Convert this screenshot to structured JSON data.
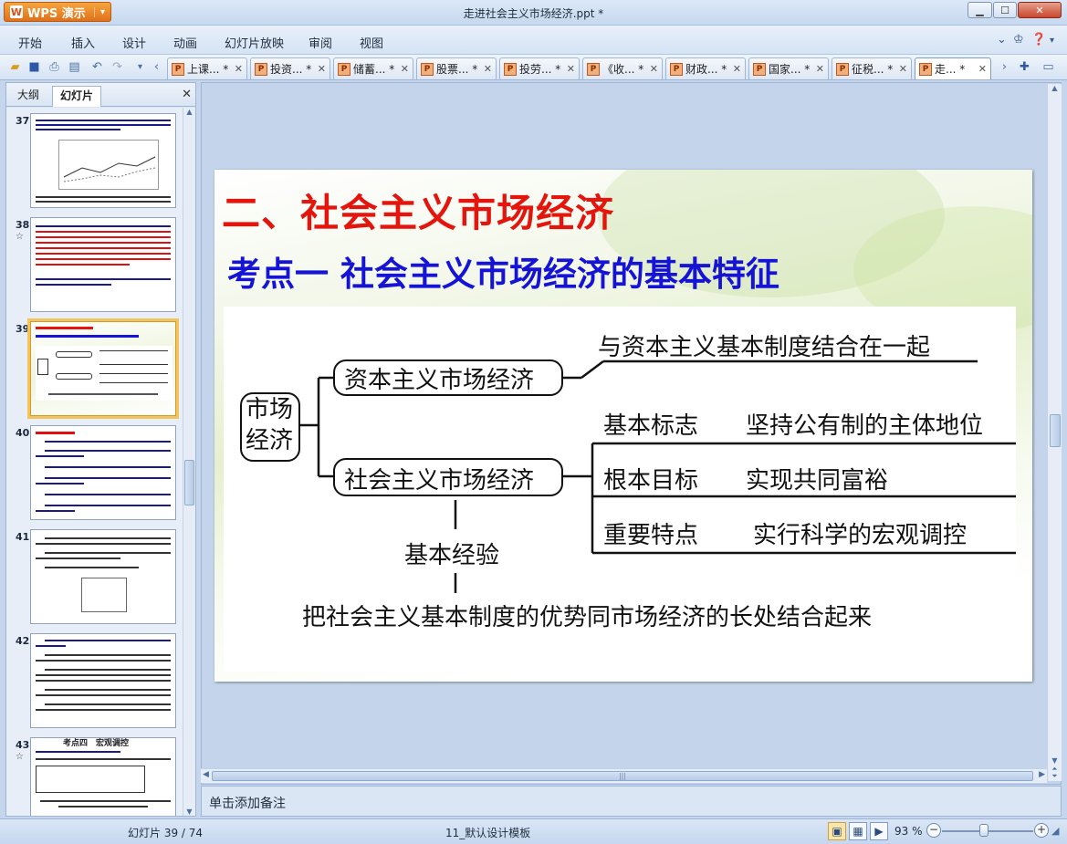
{
  "app": {
    "brand": "WPS 演示",
    "window_title": "走进社会主义市场经济.ppt *"
  },
  "menu": [
    "开始",
    "插入",
    "设计",
    "动画",
    "幻灯片放映",
    "审阅",
    "视图"
  ],
  "doc_tabs": [
    {
      "label": "上课...",
      "modified": "*"
    },
    {
      "label": "投资...",
      "modified": "*"
    },
    {
      "label": "储蓄...",
      "modified": "*"
    },
    {
      "label": "股票...",
      "modified": "*"
    },
    {
      "label": "投劳...",
      "modified": "*"
    },
    {
      "label": "《收...",
      "modified": "*"
    },
    {
      "label": "财政...",
      "modified": "*"
    },
    {
      "label": "国家...",
      "modified": "*"
    },
    {
      "label": "征税...",
      "modified": "*"
    },
    {
      "label": "走...",
      "modified": "*"
    }
  ],
  "left_panel": {
    "tabs": [
      "大纲",
      "幻灯片"
    ],
    "active_tab": "幻灯片",
    "slides": [
      {
        "num": "37",
        "star": ""
      },
      {
        "num": "38",
        "star": "☆"
      },
      {
        "num": "39",
        "star": ""
      },
      {
        "num": "40",
        "star": ""
      },
      {
        "num": "41",
        "star": ""
      },
      {
        "num": "42",
        "star": ""
      },
      {
        "num": "43",
        "star": "☆"
      }
    ],
    "thumb_43_title": "考点四　宏观调控"
  },
  "slide": {
    "title": "二、社会主义市场经济",
    "subtitle": "考点一  社会主义市场经济的基本特征",
    "diagram": {
      "root": "市场\n经济",
      "node_capitalist": "资本主义市场经济",
      "capitalist_desc": "与资本主义基本制度结合在一起",
      "node_socialist": "社会主义市场经济",
      "features": [
        {
          "label": "基本标志",
          "value": "坚持公有制的主体地位"
        },
        {
          "label": "根本目标",
          "value": "实现共同富裕"
        },
        {
          "label": "重要特点",
          "value": "实行科学的宏观调控"
        }
      ],
      "experience_label": "基本经验",
      "experience_text": "把社会主义基本制度的优势同市场经济的长处结合起来"
    }
  },
  "notes_placeholder": "单击添加备注",
  "status": {
    "slide_pos": "幻灯片 39 / 74",
    "template": "11_默认设计模板",
    "zoom": "93 %"
  }
}
